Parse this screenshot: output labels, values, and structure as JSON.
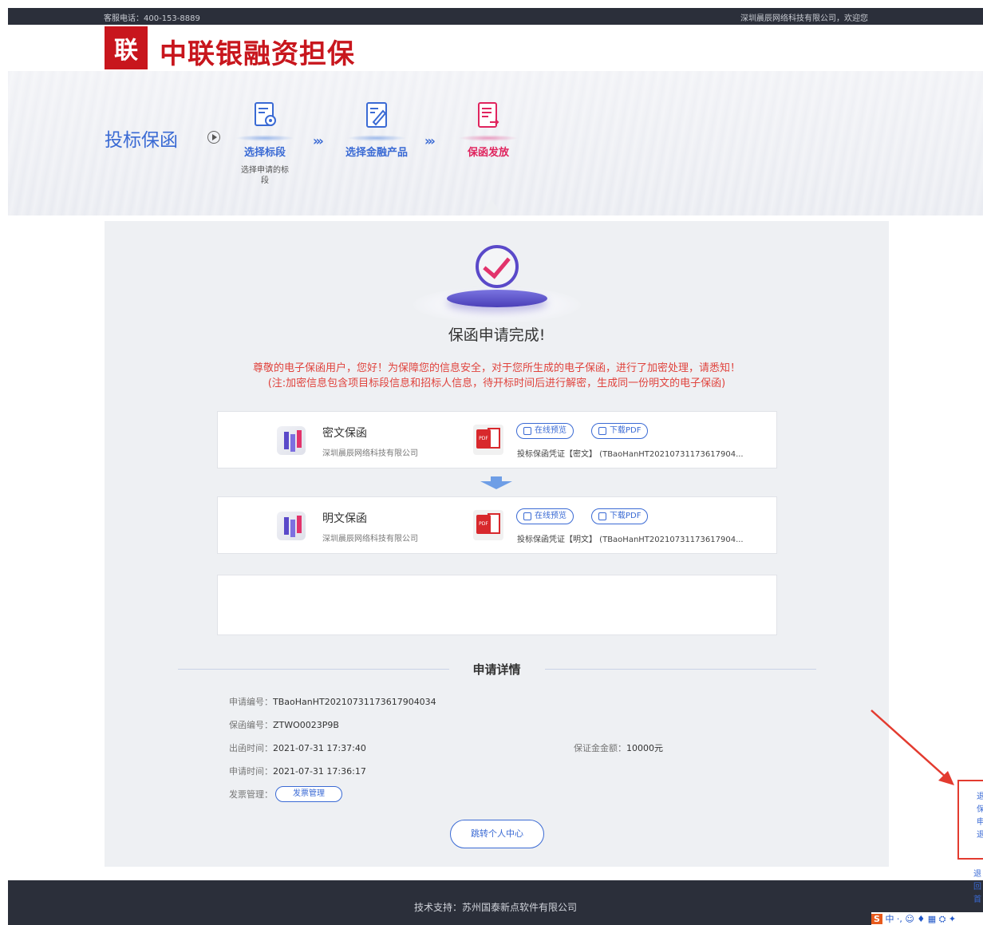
{
  "topbar": {
    "phone": "客服电话：400-153-8889",
    "welcome": "深圳晨辰网络科技有限公司，欢迎您"
  },
  "brand": {
    "logo_char": "联",
    "name": "中联银融资担保"
  },
  "banner": {
    "section_title": "投标保函",
    "steps": [
      {
        "label": "选择标段",
        "desc": "选择申请的标段",
        "icon": "document-seal-icon",
        "active": false
      },
      {
        "label": "选择金融产品",
        "desc": "",
        "icon": "edit-document-icon",
        "active": false
      },
      {
        "label": "保函发放",
        "desc": "",
        "icon": "issue-document-icon",
        "active": true
      }
    ],
    "arrow_glyph": "›››"
  },
  "result": {
    "title": "保函申请完成!",
    "notice_line1": "尊敬的电子保函用户，您好！为保障您的信息安全，对于您所生成的电子保函，进行了加密处理，请悉知！",
    "notice_line2": "(注:加密信息包含项目标段信息和招标人信息，待开标时间后进行解密，生成同一份明文的电子保函)"
  },
  "cards": [
    {
      "title": "密文保函",
      "company": "深圳晨辰网络科技有限公司",
      "preview_label": "在线预览",
      "download_label": "下载PDF",
      "file_name": "投标保函凭证【密文】 (TBaoHanHT20210731173617904..."
    },
    {
      "title": "明文保函",
      "company": "深圳晨辰网络科技有限公司",
      "preview_label": "在线预览",
      "download_label": "下载PDF",
      "file_name": "投标保函凭证【明文】 (TBaoHanHT20210731173617904..."
    }
  ],
  "details": {
    "heading": "申请详情",
    "apply_no_key": "申请编号：",
    "apply_no": "TBaoHanHT20210731173617904034",
    "guarantee_no_key": "保函编号：",
    "guarantee_no": "ZTWO0023P9B",
    "issue_time_key": "出函时间：",
    "issue_time": "2021-07-31 17:37:40",
    "deposit_key": "保证金金额：",
    "deposit": "10000元",
    "apply_time_key": "申请时间：",
    "apply_time": "2021-07-31 17:36:17",
    "invoice_key": "发票管理：",
    "invoice_button": "发票管理",
    "center_button": "跳转个人中心"
  },
  "footer": {
    "support": "技术支持：苏州国泰新点软件有限公司"
  },
  "side": {
    "tab_text": "退 保 申 退",
    "tab2_text": "退 回 首"
  },
  "ime": {
    "logo": "S",
    "text": "中 ·, ☺ ♦ ▦ ⛭ ✦"
  },
  "colors": {
    "accent": "#3a6ad4",
    "brand_red": "#c8161d",
    "notice_red": "#e0433d",
    "active_pink": "#e0245e",
    "dark": "#2b2f3a"
  }
}
